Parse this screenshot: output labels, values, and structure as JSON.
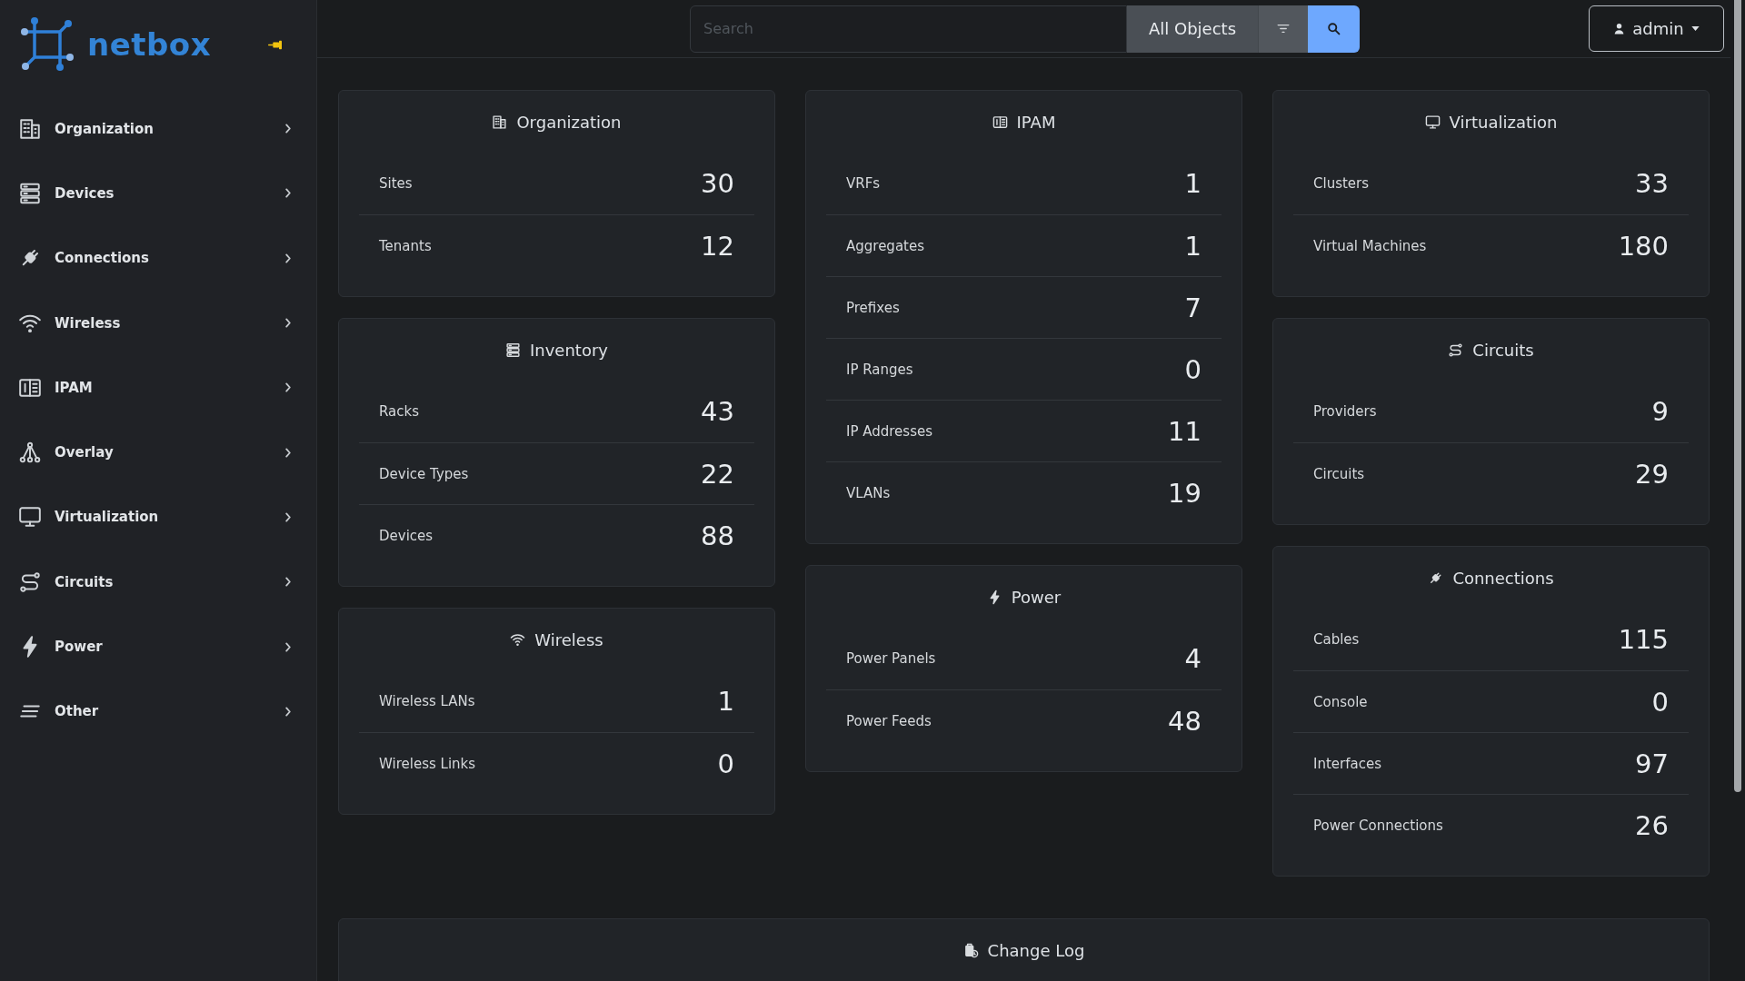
{
  "sidebar": {
    "brand": "netbox",
    "items": [
      {
        "label": "Organization",
        "expanded": false
      },
      {
        "label": "Devices",
        "expanded": false
      },
      {
        "label": "Connections",
        "expanded": false
      },
      {
        "label": "Wireless",
        "expanded": false
      },
      {
        "label": "IPAM",
        "expanded": false
      },
      {
        "label": "Overlay",
        "expanded": false
      },
      {
        "label": "Virtualization",
        "expanded": false
      },
      {
        "label": "Circuits",
        "expanded": false
      },
      {
        "label": "Power",
        "expanded": false
      },
      {
        "label": "Other",
        "expanded": false
      }
    ]
  },
  "topbar": {
    "search": {
      "placeholder": "Search"
    },
    "scope_button": "All Objects",
    "user_menu": "admin"
  },
  "columns": [
    [
      {
        "title": "Organization",
        "rows": [
          {
            "label": "Sites",
            "count": "30"
          },
          {
            "label": "Tenants",
            "count": "12"
          }
        ]
      },
      {
        "title": "Inventory",
        "rows": [
          {
            "label": "Racks",
            "count": "43"
          },
          {
            "label": "Device Types",
            "count": "22"
          },
          {
            "label": "Devices",
            "count": "88"
          }
        ]
      },
      {
        "title": "Wireless",
        "rows": [
          {
            "label": "Wireless LANs",
            "count": "1"
          },
          {
            "label": "Wireless Links",
            "count": "0"
          }
        ]
      }
    ],
    [
      {
        "title": "IPAM",
        "rows": [
          {
            "label": "VRFs",
            "count": "1"
          },
          {
            "label": "Aggregates",
            "count": "1"
          },
          {
            "label": "Prefixes",
            "count": "7"
          },
          {
            "label": "IP Ranges",
            "count": "0"
          },
          {
            "label": "IP Addresses",
            "count": "11"
          },
          {
            "label": "VLANs",
            "count": "19"
          }
        ]
      },
      {
        "title": "Power",
        "rows": [
          {
            "label": "Power Panels",
            "count": "4"
          },
          {
            "label": "Power Feeds",
            "count": "48"
          }
        ]
      }
    ],
    [
      {
        "title": "Virtualization",
        "rows": [
          {
            "label": "Clusters",
            "count": "33"
          },
          {
            "label": "Virtual Machines",
            "count": "180"
          }
        ]
      },
      {
        "title": "Circuits",
        "rows": [
          {
            "label": "Providers",
            "count": "9"
          },
          {
            "label": "Circuits",
            "count": "29"
          }
        ]
      },
      {
        "title": "Connections",
        "rows": [
          {
            "label": "Cables",
            "count": "115"
          },
          {
            "label": "Console",
            "count": "0"
          },
          {
            "label": "Interfaces",
            "count": "97"
          },
          {
            "label": "Power Connections",
            "count": "26"
          }
        ]
      }
    ]
  ],
  "change_log": {
    "title": "Change Log"
  }
}
